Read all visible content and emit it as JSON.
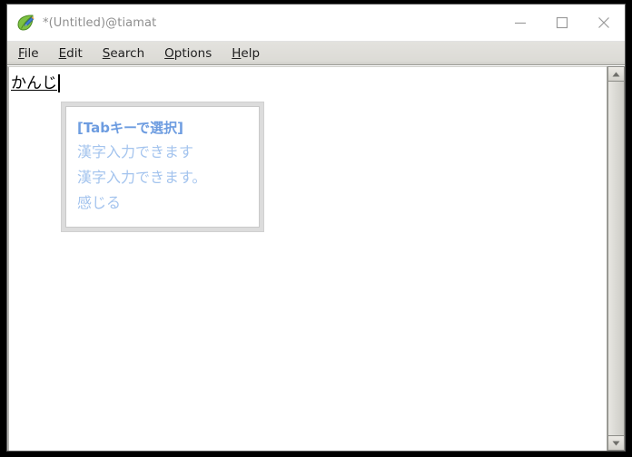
{
  "window": {
    "title": "*(Untitled)@tiamat",
    "icon": "leafpad-leaf-icon",
    "controls": {
      "minimize": "minimize-icon",
      "maximize": "maximize-icon",
      "close": "close-icon"
    }
  },
  "menu": {
    "items": [
      {
        "label": "File",
        "mnemonic": "F",
        "rest": "ile"
      },
      {
        "label": "Edit",
        "mnemonic": "E",
        "rest": "dit"
      },
      {
        "label": "Search",
        "mnemonic": "S",
        "rest": "earch"
      },
      {
        "label": "Options",
        "mnemonic": "O",
        "rest": "ptions"
      },
      {
        "label": "Help",
        "mnemonic": "H",
        "rest": "elp"
      }
    ]
  },
  "editor": {
    "preedit_text": "かんじ",
    "caret": "text-caret"
  },
  "ime_popup": {
    "hint": "[Tabキーで選択]",
    "candidates": [
      "漢字入力できます",
      "漢字入力できます。",
      "感じる"
    ]
  },
  "scrollbar": {
    "up_arrow": "scroll-up-icon",
    "down_arrow": "scroll-down-icon"
  },
  "colors": {
    "title_text": "#8e8e8e",
    "menu_bar": "#dcdbd6",
    "ime_hint": "#6d9ce0",
    "ime_candidate": "#a4c4ee",
    "window_border": "#000000"
  }
}
